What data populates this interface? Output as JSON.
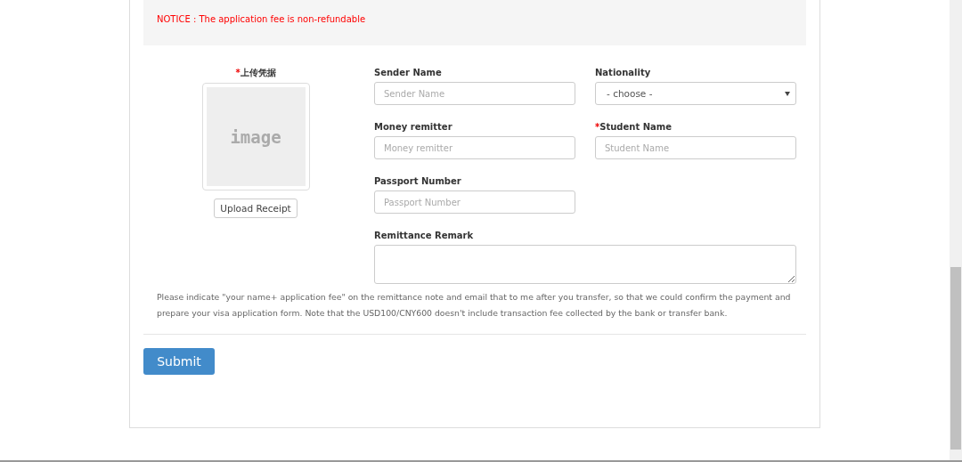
{
  "notice": "NOTICE : The application fee is non-refundable",
  "upload": {
    "label": "上传凭据",
    "required_mark": "*",
    "preview_text": "image",
    "button": "Upload Receipt"
  },
  "fields": [
    {
      "kind": "input",
      "label": "Sender Name",
      "placeholder": "Sender Name"
    },
    {
      "kind": "select",
      "label": "Nationality",
      "value": "- choose -"
    },
    {
      "kind": "input",
      "label": "Money remitter",
      "placeholder": "Money remitter"
    },
    {
      "kind": "input",
      "label": "Student Name",
      "required_mark": "*",
      "placeholder": "Student Name"
    },
    {
      "kind": "input",
      "label": "Passport Number",
      "placeholder": "Passport Number"
    },
    {
      "kind": "textarea",
      "label": "Remittance Remark"
    }
  ],
  "instructions": "Please indicate \"your name+ application fee\" on the remittance note and email that to me after you transfer, so that we could confirm the payment and prepare your visa application form. Note that the USD100/CNY600 doesn't include transaction fee collected by the bank or transfer bank.",
  "submit": "Submit"
}
